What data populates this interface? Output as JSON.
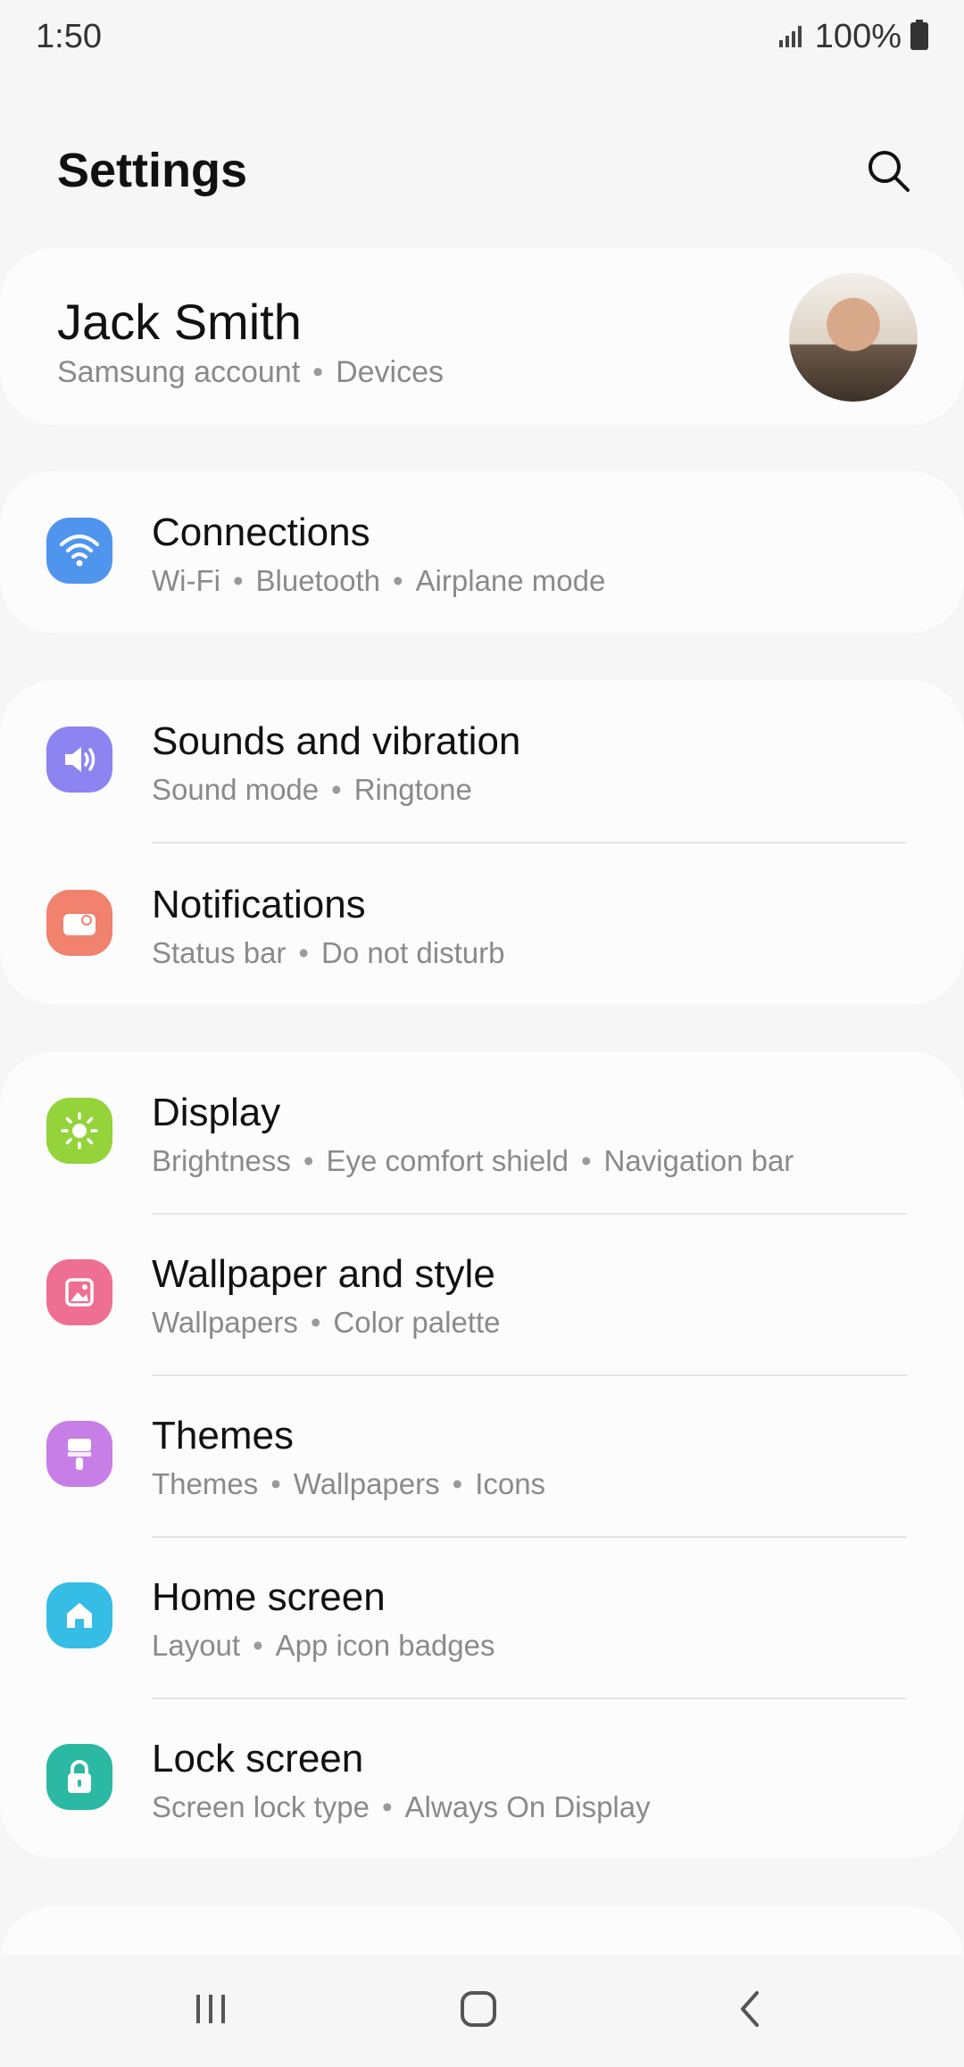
{
  "status_bar": {
    "time": "1:50",
    "battery_pct": "100%",
    "icons": [
      "signal-icon",
      "battery-icon"
    ]
  },
  "header": {
    "title": "Settings",
    "search_icon": "search-icon"
  },
  "account": {
    "name": "Jack Smith",
    "sub": [
      "Samsung account",
      "Devices"
    ]
  },
  "groups": [
    [
      {
        "title": "Connections",
        "sub": [
          "Wi-Fi",
          "Bluetooth",
          "Airplane mode"
        ],
        "icon": "wifi-icon",
        "color": "#4f95ee"
      }
    ],
    [
      {
        "title": "Sounds and vibration",
        "sub": [
          "Sound mode",
          "Ringtone"
        ],
        "icon": "volume-icon",
        "color": "#8c84f0"
      },
      {
        "title": "Notifications",
        "sub": [
          "Status bar",
          "Do not disturb"
        ],
        "icon": "notification-icon",
        "color": "#f0826e"
      }
    ],
    [
      {
        "title": "Display",
        "sub": [
          "Brightness",
          "Eye comfort shield",
          "Navigation bar"
        ],
        "icon": "brightness-icon",
        "color": "#94d33a"
      },
      {
        "title": "Wallpaper and style",
        "sub": [
          "Wallpapers",
          "Color palette"
        ],
        "icon": "wallpaper-icon",
        "color": "#ee6f91"
      },
      {
        "title": "Themes",
        "sub": [
          "Themes",
          "Wallpapers",
          "Icons"
        ],
        "icon": "themes-icon",
        "color": "#c77ee6"
      },
      {
        "title": "Home screen",
        "sub": [
          "Layout",
          "App icon badges"
        ],
        "icon": "home-screen-icon",
        "color": "#35bde5"
      },
      {
        "title": "Lock screen",
        "sub": [
          "Screen lock type",
          "Always On Display"
        ],
        "icon": "lock-icon",
        "color": "#2bb9a3"
      }
    ]
  ],
  "nav_bar": {
    "icons": [
      "recent-apps-icon",
      "home-icon",
      "back-icon"
    ]
  }
}
